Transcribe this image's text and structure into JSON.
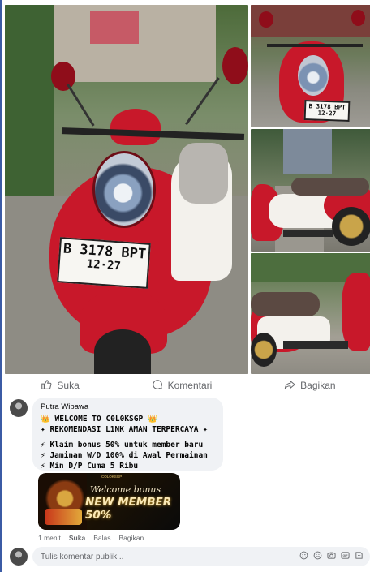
{
  "post": {
    "photos": [
      {
        "name": "main-photo",
        "plate_line1": "B 3178 BPT",
        "plate_line2": "12·27"
      },
      {
        "name": "thumb-front",
        "plate_line1": "B 3178 BPT",
        "plate_line2": "12·27"
      },
      {
        "name": "thumb-side",
        "plate_line1": "",
        "plate_line2": ""
      },
      {
        "name": "thumb-rear",
        "plate_line1": "",
        "plate_line2": ""
      }
    ],
    "actions": {
      "like_label": "Suka",
      "comment_label": "Komentari",
      "share_label": "Bagikan"
    }
  },
  "comment": {
    "author": "Putra Wibawa",
    "lines": [
      "👑 WELCOME TO C0L0KSGP 👑",
      "✦ REKOMENDASI L1NK AMAN TERPERCAYA ✦",
      "⚡ Klaim bonus 50% untuk member baru",
      "⚡ Jaminan W/D 100% di Awal Permainan",
      "⚡ Min D/P Cuma 5 Ribu"
    ],
    "banner": {
      "logo": "COLOKSGP",
      "title": "Welcome bonus",
      "main": "NEW MEMBER 50%"
    },
    "meta": {
      "time": "1 menit",
      "like": "Suka",
      "reply": "Balas",
      "share": "Bagikan"
    }
  },
  "composer": {
    "placeholder": "Tulis komentar publik..."
  },
  "colors": {
    "accent_border": "#3b5ba5",
    "scooter_red": "#c8182a",
    "bubble_bg": "#f0f2f5",
    "muted_text": "#65676b"
  },
  "icons": [
    "like-icon",
    "comment-icon",
    "share-icon",
    "sticker-icon",
    "emoji-icon",
    "camera-icon",
    "gif-icon",
    "avatar-sticker-icon"
  ]
}
